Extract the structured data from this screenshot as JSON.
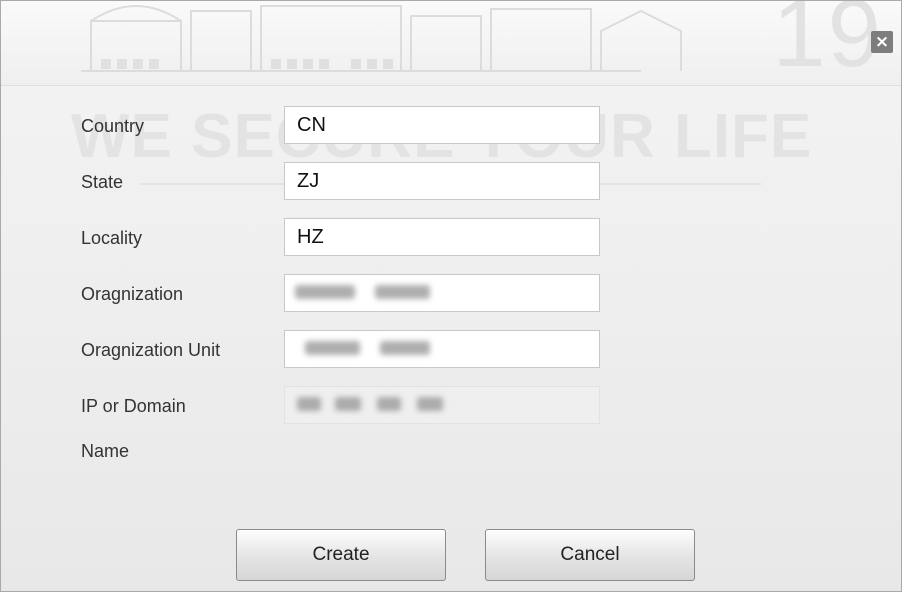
{
  "dialog": {
    "close_icon": "×",
    "watermark": {
      "slogan": "WE SECURE YOUR LIFE",
      "year": "19",
      "stars": "★★★★★★★"
    }
  },
  "form": {
    "fields": [
      {
        "label": "Country",
        "value": "CN"
      },
      {
        "label": "State",
        "value": "ZJ"
      },
      {
        "label": "Locality",
        "value": "HZ"
      },
      {
        "label": "Oragnization",
        "value": ""
      },
      {
        "label": "Oragnization Unit",
        "value": ""
      },
      {
        "label": "IP or Domain",
        "label_line2": "Name",
        "value": ""
      }
    ]
  },
  "buttons": {
    "create": "Create",
    "cancel": "Cancel"
  }
}
